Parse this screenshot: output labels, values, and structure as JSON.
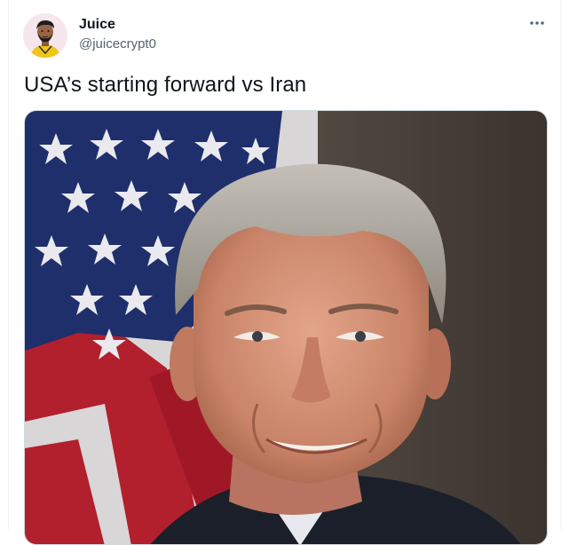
{
  "tweet": {
    "author_name": "Juice",
    "author_handle": "@juicecrypt0",
    "text": "USA’s starting forward vs Iran",
    "more_icon": "more-horizontal-icon",
    "avatar_icon": "cartoon-avatar",
    "media_description_icon": "portrait-photo"
  }
}
